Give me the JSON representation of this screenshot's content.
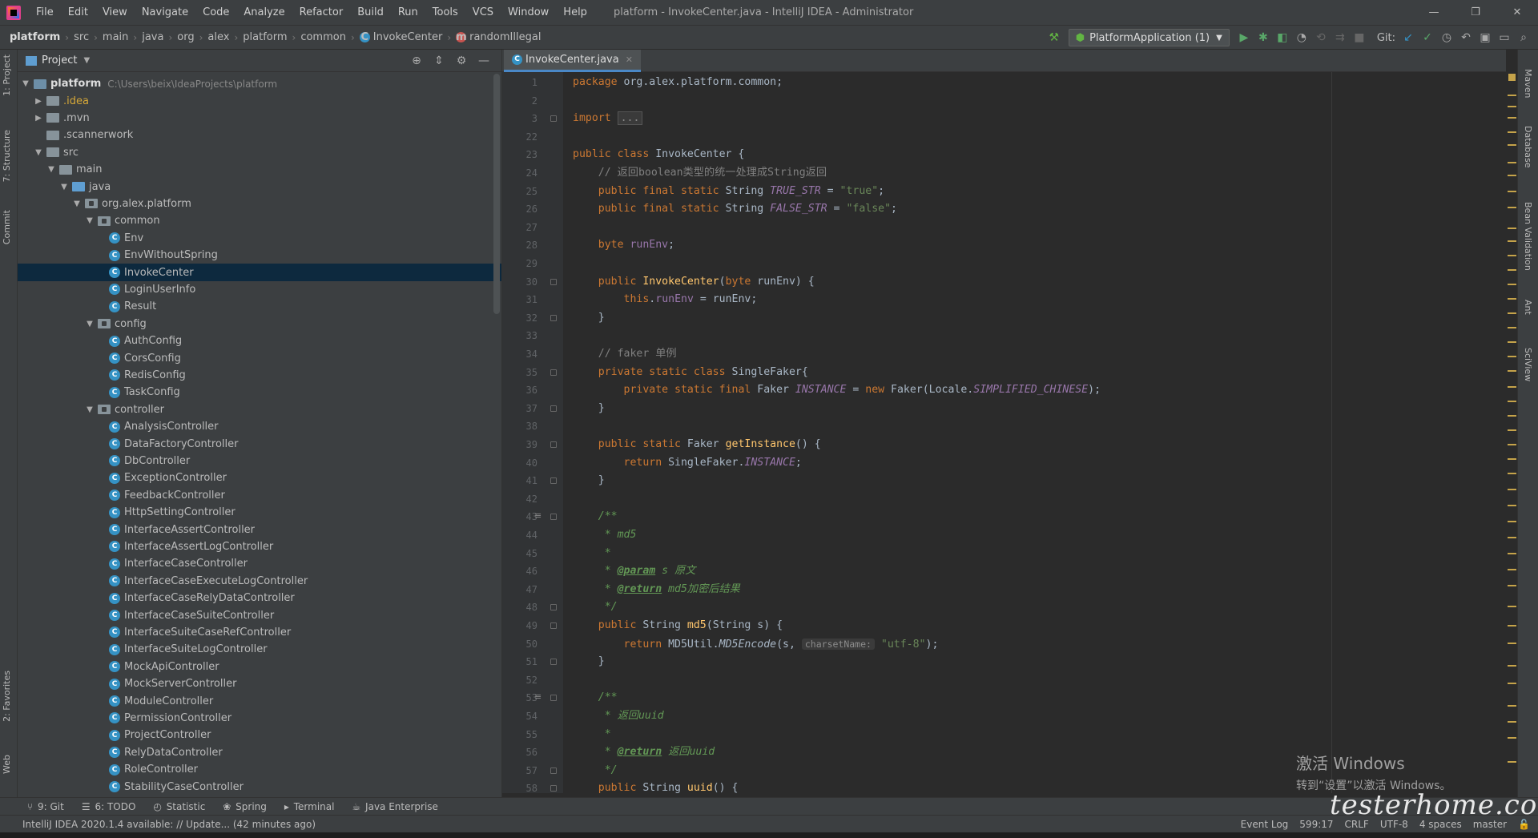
{
  "menu": [
    "File",
    "Edit",
    "View",
    "Navigate",
    "Code",
    "Analyze",
    "Refactor",
    "Build",
    "Run",
    "Tools",
    "VCS",
    "Window",
    "Help"
  ],
  "window_title": "platform - InvokeCenter.java - IntelliJ IDEA - Administrator",
  "window_controls": [
    "—",
    "❐",
    "✕"
  ],
  "breadcrumbs": [
    "platform",
    "src",
    "main",
    "java",
    "org",
    "alex",
    "platform",
    "common",
    "InvokeCenter",
    "randomIllegal"
  ],
  "toolbar": {
    "run_config": "PlatformApplication (1)",
    "git_label": "Git:"
  },
  "left_stripe": {
    "project": "1: Project",
    "structure": "7: Structure",
    "commit": "Commit",
    "favorites": "2: Favorites",
    "web": "Web"
  },
  "right_stripe": {
    "maven": "Maven",
    "database": "Database",
    "bean": "Bean Validation",
    "ant": "Ant",
    "sciview": "SciView"
  },
  "project": {
    "title": "Project",
    "tree": [
      {
        "label": "platform",
        "path": "C:\\Users\\beix\\IdeaProjects\\platform",
        "kind": "project",
        "depth": 0,
        "arrow": "▼"
      },
      {
        "label": ".idea",
        "kind": "folder-idea",
        "depth": 1,
        "arrow": "▶"
      },
      {
        "label": ".mvn",
        "kind": "folder",
        "depth": 1,
        "arrow": "▶"
      },
      {
        "label": ".scannerwork",
        "kind": "folder",
        "depth": 1,
        "arrow": ""
      },
      {
        "label": "src",
        "kind": "folder",
        "depth": 1,
        "arrow": "▼"
      },
      {
        "label": "main",
        "kind": "folder",
        "depth": 2,
        "arrow": "▼"
      },
      {
        "label": "java",
        "kind": "folder-blue",
        "depth": 3,
        "arrow": "▼"
      },
      {
        "label": "org.alex.platform",
        "kind": "package",
        "depth": 4,
        "arrow": "▼"
      },
      {
        "label": "common",
        "kind": "package",
        "depth": 5,
        "arrow": "▼"
      },
      {
        "label": "Env",
        "kind": "class",
        "depth": 6
      },
      {
        "label": "EnvWithoutSpring",
        "kind": "class",
        "depth": 6
      },
      {
        "label": "InvokeCenter",
        "kind": "class",
        "depth": 6,
        "selected": true
      },
      {
        "label": "LoginUserInfo",
        "kind": "class",
        "depth": 6
      },
      {
        "label": "Result",
        "kind": "class",
        "depth": 6
      },
      {
        "label": "config",
        "kind": "package",
        "depth": 5,
        "arrow": "▼"
      },
      {
        "label": "AuthConfig",
        "kind": "class",
        "depth": 6
      },
      {
        "label": "CorsConfig",
        "kind": "class",
        "depth": 6
      },
      {
        "label": "RedisConfig",
        "kind": "class",
        "depth": 6
      },
      {
        "label": "TaskConfig",
        "kind": "class",
        "depth": 6
      },
      {
        "label": "controller",
        "kind": "package",
        "depth": 5,
        "arrow": "▼"
      },
      {
        "label": "AnalysisController",
        "kind": "class",
        "depth": 6
      },
      {
        "label": "DataFactoryController",
        "kind": "class",
        "depth": 6
      },
      {
        "label": "DbController",
        "kind": "class",
        "depth": 6
      },
      {
        "label": "ExceptionController",
        "kind": "class",
        "depth": 6
      },
      {
        "label": "FeedbackController",
        "kind": "class",
        "depth": 6
      },
      {
        "label": "HttpSettingController",
        "kind": "class",
        "depth": 6
      },
      {
        "label": "InterfaceAssertController",
        "kind": "class",
        "depth": 6
      },
      {
        "label": "InterfaceAssertLogController",
        "kind": "class",
        "depth": 6
      },
      {
        "label": "InterfaceCaseController",
        "kind": "class",
        "depth": 6
      },
      {
        "label": "InterfaceCaseExecuteLogController",
        "kind": "class",
        "depth": 6
      },
      {
        "label": "InterfaceCaseRelyDataController",
        "kind": "class",
        "depth": 6
      },
      {
        "label": "InterfaceCaseSuiteController",
        "kind": "class",
        "depth": 6
      },
      {
        "label": "InterfaceSuiteCaseRefController",
        "kind": "class",
        "depth": 6
      },
      {
        "label": "InterfaceSuiteLogController",
        "kind": "class",
        "depth": 6
      },
      {
        "label": "MockApiController",
        "kind": "class",
        "depth": 6
      },
      {
        "label": "MockServerController",
        "kind": "class",
        "depth": 6
      },
      {
        "label": "ModuleController",
        "kind": "class",
        "depth": 6
      },
      {
        "label": "PermissionController",
        "kind": "class",
        "depth": 6
      },
      {
        "label": "ProjectController",
        "kind": "class",
        "depth": 6
      },
      {
        "label": "RelyDataController",
        "kind": "class",
        "depth": 6
      },
      {
        "label": "RoleController",
        "kind": "class",
        "depth": 6
      },
      {
        "label": "StabilityCaseController",
        "kind": "class",
        "depth": 6
      }
    ]
  },
  "editor": {
    "tab": "InvokeCenter.java",
    "line_numbers": [
      "1",
      "2",
      "3",
      "22",
      "23",
      "24",
      "25",
      "26",
      "27",
      "28",
      "29",
      "30",
      "31",
      "32",
      "33",
      "34",
      "35",
      "36",
      "37",
      "38",
      "39",
      "40",
      "41",
      "42",
      "43",
      "44",
      "45",
      "46",
      "47",
      "48",
      "49",
      "50",
      "51",
      "52",
      "53",
      "54",
      "55",
      "56",
      "57",
      "58"
    ],
    "lines": [
      [
        [
          "kw",
          "package "
        ],
        [
          "",
          "org.alex.platform.common;"
        ]
      ],
      [],
      [
        [
          "kw",
          "import "
        ],
        [
          "foldbox",
          "..."
        ]
      ],
      [],
      [
        [
          "kw",
          "public class "
        ],
        [
          "",
          "InvokeCenter {"
        ]
      ],
      [
        [
          "",
          "    "
        ],
        [
          "cm",
          "// 返回boolean类型的统一处理成String返回"
        ]
      ],
      [
        [
          "",
          "    "
        ],
        [
          "kw",
          "public final static "
        ],
        [
          "",
          "String "
        ],
        [
          "st",
          "TRUE_STR"
        ],
        [
          "",
          " = "
        ],
        [
          "str",
          "\"true\""
        ],
        [
          "",
          ";"
        ]
      ],
      [
        [
          "",
          "    "
        ],
        [
          "kw",
          "public final static "
        ],
        [
          "",
          "String "
        ],
        [
          "st",
          "FALSE_STR"
        ],
        [
          "",
          " = "
        ],
        [
          "str",
          "\"false\""
        ],
        [
          "",
          ";"
        ]
      ],
      [],
      [
        [
          "",
          "    "
        ],
        [
          "kw",
          "byte "
        ],
        [
          "fld",
          "runEnv"
        ],
        [
          "",
          ";"
        ]
      ],
      [],
      [
        [
          "",
          "    "
        ],
        [
          "kw",
          "public "
        ],
        [
          "fn",
          "InvokeCenter"
        ],
        [
          "",
          "("
        ],
        [
          "kw",
          "byte "
        ],
        [
          "",
          "runEnv) {"
        ]
      ],
      [
        [
          "",
          "        "
        ],
        [
          "kw",
          "this"
        ],
        [
          "",
          "."
        ],
        [
          "fld",
          "runEnv"
        ],
        [
          "",
          " = runEnv;"
        ]
      ],
      [
        [
          "",
          "    }"
        ]
      ],
      [],
      [
        [
          "",
          "    "
        ],
        [
          "cm",
          "// faker 单例"
        ]
      ],
      [
        [
          "",
          "    "
        ],
        [
          "kw",
          "private static class "
        ],
        [
          "",
          "SingleFaker{"
        ]
      ],
      [
        [
          "",
          "        "
        ],
        [
          "kw",
          "private static final "
        ],
        [
          "",
          "Faker "
        ],
        [
          "st",
          "INSTANCE"
        ],
        [
          "",
          " = "
        ],
        [
          "kw",
          "new "
        ],
        [
          "",
          "Faker(Locale."
        ],
        [
          "st",
          "SIMPLIFIED_CHINESE"
        ],
        [
          "",
          ");"
        ]
      ],
      [
        [
          "",
          "    }"
        ]
      ],
      [],
      [
        [
          "",
          "    "
        ],
        [
          "kw",
          "public static "
        ],
        [
          "",
          "Faker "
        ],
        [
          "fn",
          "getInstance"
        ],
        [
          "",
          "() {"
        ]
      ],
      [
        [
          "",
          "        "
        ],
        [
          "kw",
          "return "
        ],
        [
          "",
          "SingleFaker."
        ],
        [
          "st",
          "INSTANCE"
        ],
        [
          "",
          ";"
        ]
      ],
      [
        [
          "",
          "    }"
        ]
      ],
      [],
      [
        [
          "",
          "    "
        ],
        [
          "dc",
          "/**"
        ]
      ],
      [
        [
          "",
          "     "
        ],
        [
          "dc",
          "* md5"
        ]
      ],
      [
        [
          "",
          "     "
        ],
        [
          "dc",
          "*"
        ]
      ],
      [
        [
          "",
          "     "
        ],
        [
          "dc",
          "* "
        ],
        [
          "tag",
          "@param"
        ],
        [
          "dc",
          " s 原文"
        ]
      ],
      [
        [
          "",
          "     "
        ],
        [
          "dc",
          "* "
        ],
        [
          "tag",
          "@return"
        ],
        [
          "dc",
          " md5加密后结果"
        ]
      ],
      [
        [
          "",
          "     "
        ],
        [
          "dc",
          "*/"
        ]
      ],
      [
        [
          "",
          "    "
        ],
        [
          "kw",
          "public "
        ],
        [
          "",
          "String "
        ],
        [
          "fn",
          "md5"
        ],
        [
          "",
          "(String s) {"
        ]
      ],
      [
        [
          "",
          "        "
        ],
        [
          "kw",
          "return "
        ],
        [
          "",
          "MD5Util."
        ],
        [
          "mth",
          "MD5Encode"
        ],
        [
          "",
          "(s, "
        ],
        [
          "hint",
          "charsetName:"
        ],
        [
          "str",
          " \"utf-8\""
        ],
        [
          "",
          ");"
        ]
      ],
      [
        [
          "",
          "    }"
        ]
      ],
      [],
      [
        [
          "",
          "    "
        ],
        [
          "dc",
          "/**"
        ]
      ],
      [
        [
          "",
          "     "
        ],
        [
          "dc",
          "* 返回uuid"
        ]
      ],
      [
        [
          "",
          "     "
        ],
        [
          "dc",
          "*"
        ]
      ],
      [
        [
          "",
          "     "
        ],
        [
          "dc",
          "* "
        ],
        [
          "tag",
          "@return"
        ],
        [
          "dc",
          " 返回uuid"
        ]
      ],
      [
        [
          "",
          "     "
        ],
        [
          "dc",
          "*/"
        ]
      ],
      [
        [
          "",
          "    "
        ],
        [
          "kw",
          "public "
        ],
        [
          "",
          "String "
        ],
        [
          "fn",
          "uuid"
        ],
        [
          "",
          "() {"
        ]
      ]
    ]
  },
  "bottom_tools": [
    "9: Git",
    "6: TODO",
    "Statistic",
    "Spring",
    "Terminal",
    "Java Enterprise"
  ],
  "status": {
    "message": "IntelliJ IDEA 2020.1.4 available: // Update... (42 minutes ago)",
    "position": "599:17",
    "line_sep": "CRLF",
    "encoding": "UTF-8",
    "indent": "4 spaces",
    "branch": "master",
    "event_log": "Event Log"
  },
  "watermark": {
    "line1": "激活 Windows",
    "line2": "转到“设置”以激活 Windows。",
    "brand": "testerhome.com"
  }
}
